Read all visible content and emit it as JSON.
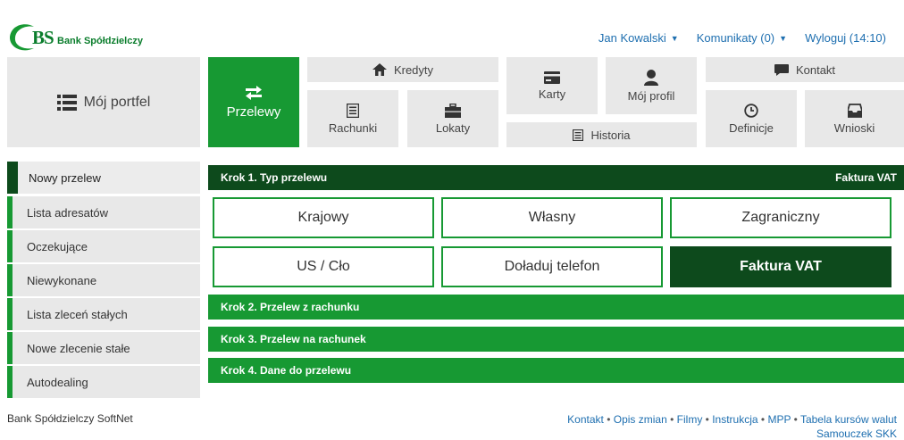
{
  "brand": {
    "logo_letters": "BS",
    "name": "Bank Spółdzielczy"
  },
  "topnav": {
    "user": "Jan Kowalski",
    "messages": "Komunikaty (0)",
    "logout": "Wyloguj (14:10)"
  },
  "tiles": {
    "portfolio": "Mój portfel",
    "transfers": "Przelewy",
    "credits": "Kredyty",
    "accounts": "Rachunki",
    "deposits": "Lokaty",
    "cards": "Karty",
    "profile": "Mój profil",
    "history": "Historia",
    "contact": "Kontakt",
    "definitions": "Definicje",
    "requests": "Wnioski"
  },
  "sidebar": {
    "items": [
      {
        "label": "Nowy przelew"
      },
      {
        "label": "Lista adresatów"
      },
      {
        "label": "Oczekujące"
      },
      {
        "label": "Niewykonane"
      },
      {
        "label": "Lista zleceń stałych"
      },
      {
        "label": "Nowe zlecenie stałe"
      },
      {
        "label": "Autodealing"
      }
    ]
  },
  "steps": {
    "step1": "Krok 1. Typ przelewu",
    "step1_selected": "Faktura VAT",
    "step2": "Krok 2. Przelew z rachunku",
    "step3": "Krok 3. Przelew na rachunek",
    "step4": "Krok 4. Dane do przelewu"
  },
  "options": {
    "domestic": "Krajowy",
    "own": "Własny",
    "foreign": "Zagraniczny",
    "us_clo": "US / Cło",
    "topup": "Doładuj telefon",
    "vat": "Faktura VAT"
  },
  "footer": {
    "left": "Bank Spółdzielczy SoftNet",
    "links": [
      "Kontakt",
      "Opis zmian",
      "Filmy",
      "Instrukcja",
      "MPP",
      "Tabela kursów walut",
      "Samouczek SKK"
    ]
  },
  "colors": {
    "green": "#179933",
    "dark_green": "#0d4a1c",
    "link": "#1e6fb0",
    "tile_bg": "#e8e8e8"
  }
}
